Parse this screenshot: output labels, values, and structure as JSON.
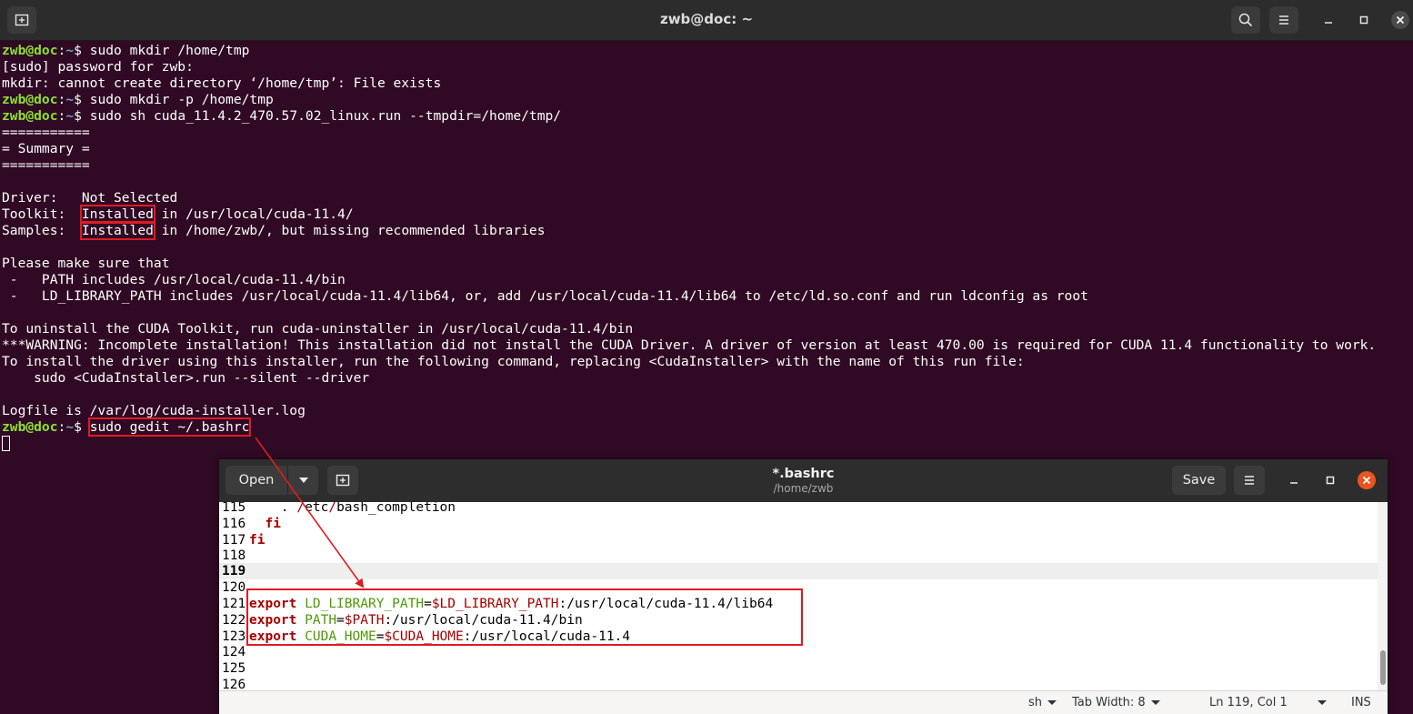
{
  "terminal": {
    "title": "zwb@doc: ~",
    "icons": {
      "new_tab": "new-tab-icon",
      "search": "search-icon",
      "menu": "hamburger-menu-icon",
      "minimize": "minimize-icon",
      "maximize": "maximize-icon",
      "close": "close-icon"
    },
    "prompt": {
      "user": "zwb@doc",
      "sep": ":",
      "path": "~",
      "sym": "$ "
    },
    "lines": [
      {
        "type": "prompt",
        "cmd": "sudo mkdir /home/tmp"
      },
      {
        "type": "text",
        "text": "[sudo] password for zwb:"
      },
      {
        "type": "text",
        "text": "mkdir: cannot create directory ‘/home/tmp’: File exists"
      },
      {
        "type": "prompt",
        "cmd": "sudo mkdir -p /home/tmp"
      },
      {
        "type": "prompt",
        "cmd": "sudo sh cuda_11.4.2_470.57.02_linux.run --tmpdir=/home/tmp/"
      },
      {
        "type": "text",
        "text": "==========="
      },
      {
        "type": "text",
        "text": "= Summary ="
      },
      {
        "type": "text",
        "text": "==========="
      },
      {
        "type": "text",
        "text": ""
      },
      {
        "type": "text",
        "text": "Driver:   Not Selected"
      },
      {
        "type": "hl",
        "pre": "Toolkit:  ",
        "hl": "Installed",
        "post": " in /usr/local/cuda-11.4/"
      },
      {
        "type": "hl",
        "pre": "Samples:  ",
        "hl": "Installed",
        "post": " in /home/zwb/, but missing recommended libraries"
      },
      {
        "type": "text",
        "text": ""
      },
      {
        "type": "text",
        "text": "Please make sure that"
      },
      {
        "type": "text",
        "text": " -   PATH includes /usr/local/cuda-11.4/bin"
      },
      {
        "type": "text",
        "text": " -   LD_LIBRARY_PATH includes /usr/local/cuda-11.4/lib64, or, add /usr/local/cuda-11.4/lib64 to /etc/ld.so.conf and run ldconfig as root"
      },
      {
        "type": "text",
        "text": ""
      },
      {
        "type": "text",
        "text": "To uninstall the CUDA Toolkit, run cuda-uninstaller in /usr/local/cuda-11.4/bin"
      },
      {
        "type": "text",
        "text": "***WARNING: Incomplete installation! This installation did not install the CUDA Driver. A driver of version at least 470.00 is required for CUDA 11.4 functionality to work."
      },
      {
        "type": "text",
        "text": "To install the driver using this installer, run the following command, replacing <CudaInstaller> with the name of this run file:"
      },
      {
        "type": "text",
        "text": "    sudo <CudaInstaller>.run --silent --driver"
      },
      {
        "type": "text",
        "text": ""
      },
      {
        "type": "text",
        "text": "Logfile is /var/log/cuda-installer.log"
      },
      {
        "type": "prompt-hl",
        "cmd": "sudo gedit ~/.bashrc"
      },
      {
        "type": "cursor"
      }
    ]
  },
  "gedit": {
    "open_label": "Open",
    "title": "*.bashrc",
    "subtitle": "/home/zwb",
    "save_label": "Save",
    "icons": {
      "dropdown": "chevron-down-icon",
      "new_tab": "new-tab-icon",
      "menu": "hamburger-menu-icon",
      "minimize": "minimize-icon",
      "maximize": "maximize-icon",
      "close": "close-icon"
    },
    "lines": [
      {
        "n": "115",
        "code": [
          {
            "t": "    . "
          },
          {
            "t": "/",
            "c": "dirsl"
          },
          {
            "t": "etc"
          },
          {
            "t": "/",
            "c": "dirsl"
          },
          {
            "t": "bash_completion"
          }
        ]
      },
      {
        "n": "116",
        "code": [
          {
            "t": "  "
          },
          {
            "t": "fi",
            "c": "kw"
          }
        ]
      },
      {
        "n": "117",
        "code": [
          {
            "t": "fi",
            "c": "kw"
          }
        ]
      },
      {
        "n": "118",
        "code": []
      },
      {
        "n": "119",
        "code": [],
        "current": true
      },
      {
        "n": "120",
        "code": []
      },
      {
        "n": "121",
        "code": [
          {
            "t": "export",
            "c": "kw"
          },
          {
            "t": " "
          },
          {
            "t": "LD_LIBRARY_PATH",
            "c": "var"
          },
          {
            "t": "="
          },
          {
            "t": "$LD_LIBRARY_PATH",
            "c": "pvar"
          },
          {
            "t": ":/usr/local/cuda-11.4/lib64"
          }
        ]
      },
      {
        "n": "122",
        "code": [
          {
            "t": "export",
            "c": "kw"
          },
          {
            "t": " "
          },
          {
            "t": "PATH",
            "c": "var"
          },
          {
            "t": "="
          },
          {
            "t": "$PATH",
            "c": "pvar"
          },
          {
            "t": ":/usr/local/cuda-11.4/bin"
          }
        ]
      },
      {
        "n": "123",
        "code": [
          {
            "t": "export",
            "c": "kw"
          },
          {
            "t": " "
          },
          {
            "t": "CUDA_HOME",
            "c": "var"
          },
          {
            "t": "="
          },
          {
            "t": "$CUDA_HOME",
            "c": "pvar"
          },
          {
            "t": ":/usr/local/cuda-11.4"
          }
        ]
      },
      {
        "n": "124",
        "code": []
      },
      {
        "n": "125",
        "code": []
      },
      {
        "n": "126",
        "code": []
      }
    ],
    "status": {
      "language": "sh",
      "tab_width": "Tab Width: 8",
      "position": "Ln 119, Col 1",
      "mode": "INS"
    }
  },
  "colors": {
    "terminal_bg": "#300a24",
    "prompt_user": "#8ae234",
    "prompt_path": "#729fcf",
    "annotation": "#e01b24",
    "gedit_close": "#e95420"
  }
}
